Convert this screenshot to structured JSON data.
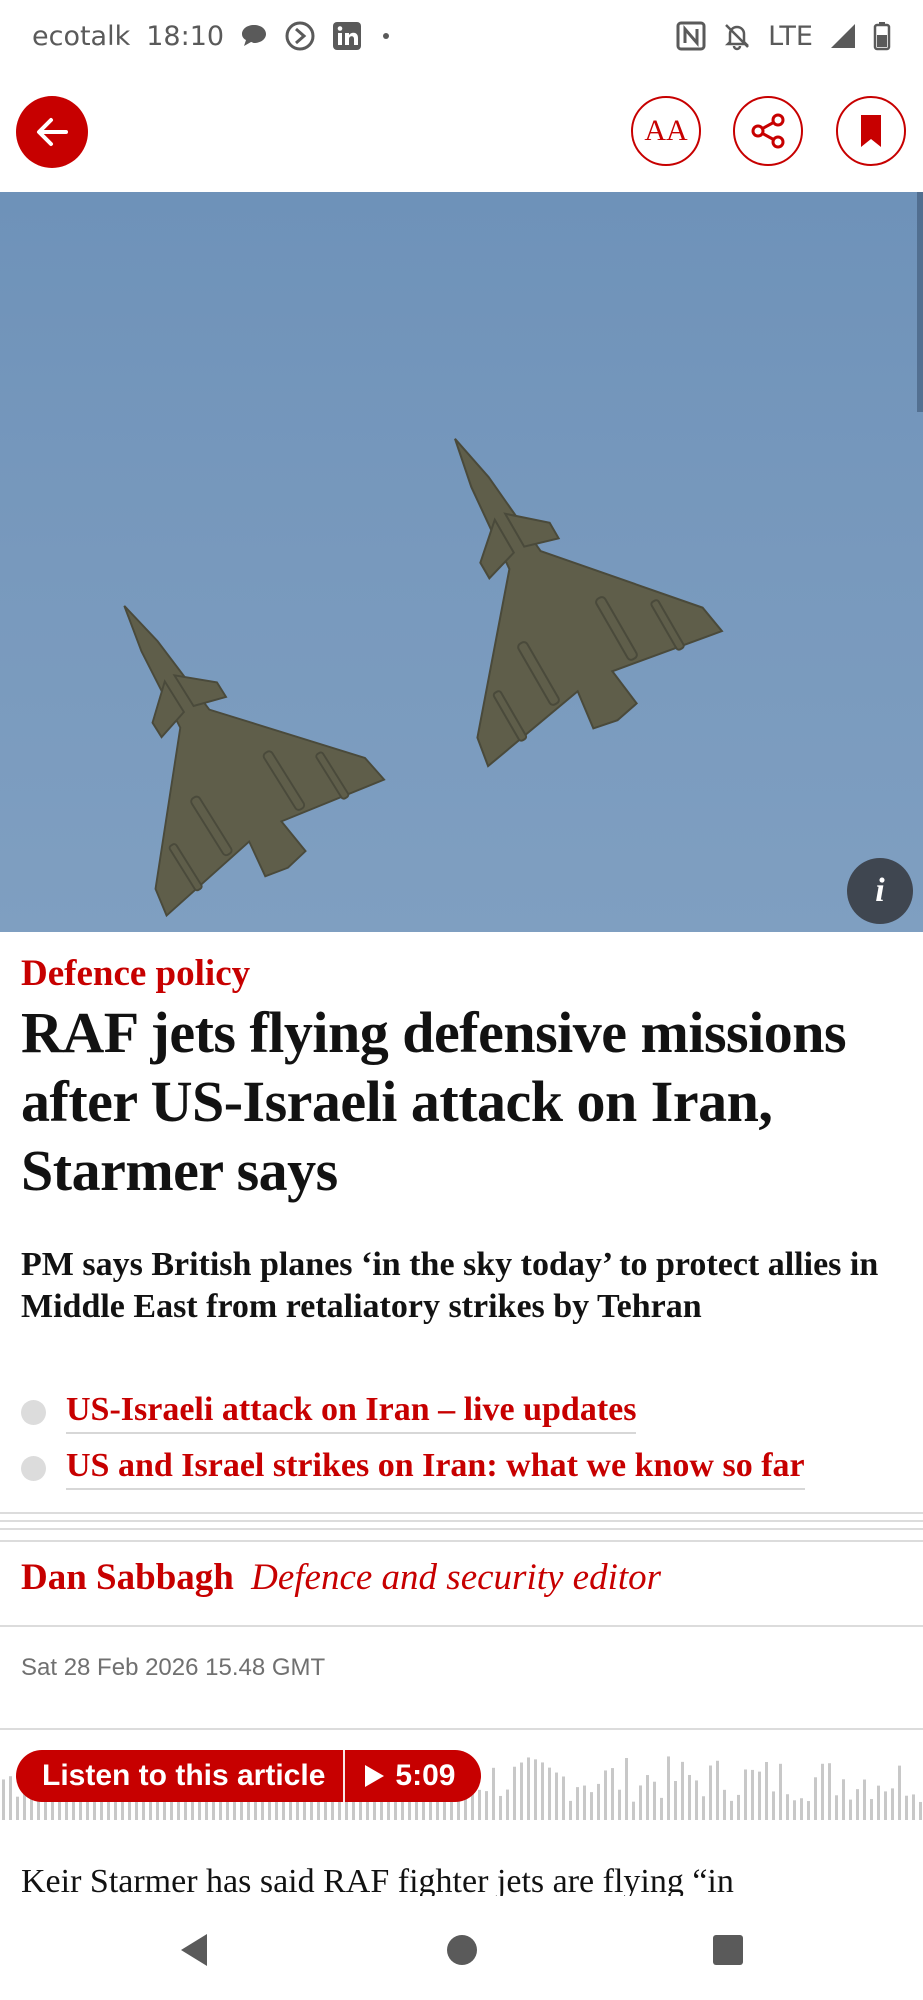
{
  "status_bar": {
    "carrier": "ecotalk",
    "time": "18:10",
    "network": "LTE",
    "left_icons": [
      "chat-bubble-icon",
      "circle-arrow-icon",
      "linkedin-icon",
      "dot-icon"
    ],
    "right_icons": [
      "nfc-icon",
      "bell-off-icon",
      "signal-icon",
      "battery-icon"
    ]
  },
  "toolbar": {
    "text_size_label": "AA",
    "icons": [
      "back-arrow-icon",
      "text-size-icon",
      "share-icon",
      "bookmark-icon"
    ]
  },
  "hero": {
    "info_label": "i",
    "background_color": "#7899bd"
  },
  "article": {
    "kicker": "Defence policy",
    "headline": "RAF jets flying defensive missions after US-Israeli attack on Iran, Starmer says",
    "standfirst": "PM says British planes ‘in the sky today’ to protect allies in Middle East from retaliatory strikes by Tehran",
    "related_links": [
      "US-Israeli attack on Iran – live updates",
      "US and Israel strikes on Iran: what we know so far"
    ],
    "author": "Dan Sabbagh",
    "author_role": "Defence and security editor",
    "dateline": "Sat 28 Feb 2026 15.48 GMT",
    "body_first_line": "Keir Starmer has said RAF fighter jets are flying “in"
  },
  "audio": {
    "listen_label": "Listen to this article",
    "duration": "5:09"
  },
  "colors": {
    "accent": "#c70000",
    "text": "#121212",
    "muted": "#707070",
    "divider": "#dcdcdc"
  },
  "nav": {
    "icons": [
      "back-triangle-icon",
      "home-circle-icon",
      "recents-square-icon"
    ]
  }
}
